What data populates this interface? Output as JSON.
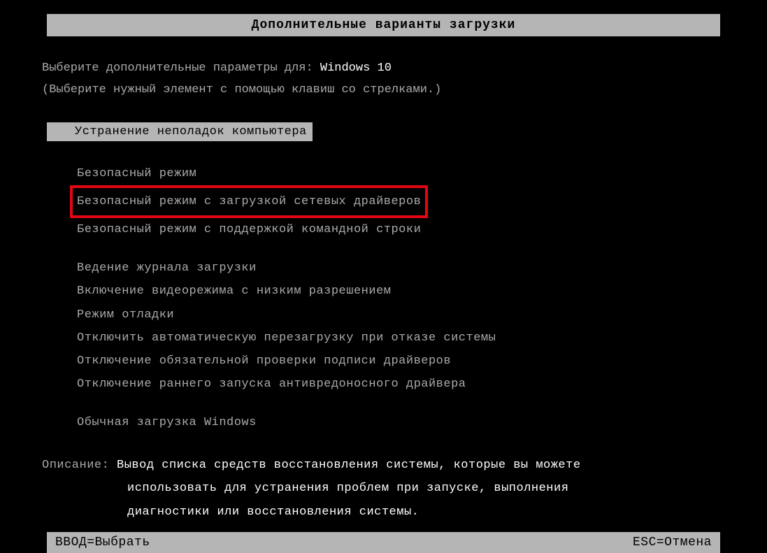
{
  "header": {
    "title": "Дополнительные варианты загрузки"
  },
  "prompt": {
    "line1_prefix": "Выберите дополнительные параметры для: ",
    "os": "Windows 10",
    "line2": "(Выберите нужный элемент с помощью клавиш со стрелками.)"
  },
  "selected": {
    "label": "Устранение неполадок компьютера"
  },
  "options": {
    "group1": [
      "Безопасный режим",
      "Безопасный режим с загрузкой сетевых драйверов",
      "Безопасный режим с поддержкой командной строки"
    ],
    "group2": [
      "Ведение журнала загрузки",
      "Включение видеорежима с низким разрешением",
      "Режим отладки",
      "Отключить автоматическую перезагрузку при отказе системы",
      "Отключение обязательной проверки подписи драйверов",
      "Отключение раннего запуска антивредоносного драйвера"
    ],
    "group3": [
      "Обычная загрузка Windows"
    ],
    "highlighted_index": 1
  },
  "description": {
    "label": "Описание: ",
    "line1": "Вывод списка средств восстановления системы, которые вы можете",
    "line2": "использовать для устранения проблем при запуске, выполнения",
    "line3": "диагностики или восстановления системы."
  },
  "footer": {
    "enter": "ВВОД=Выбрать",
    "esc": "ESC=Отмена"
  }
}
